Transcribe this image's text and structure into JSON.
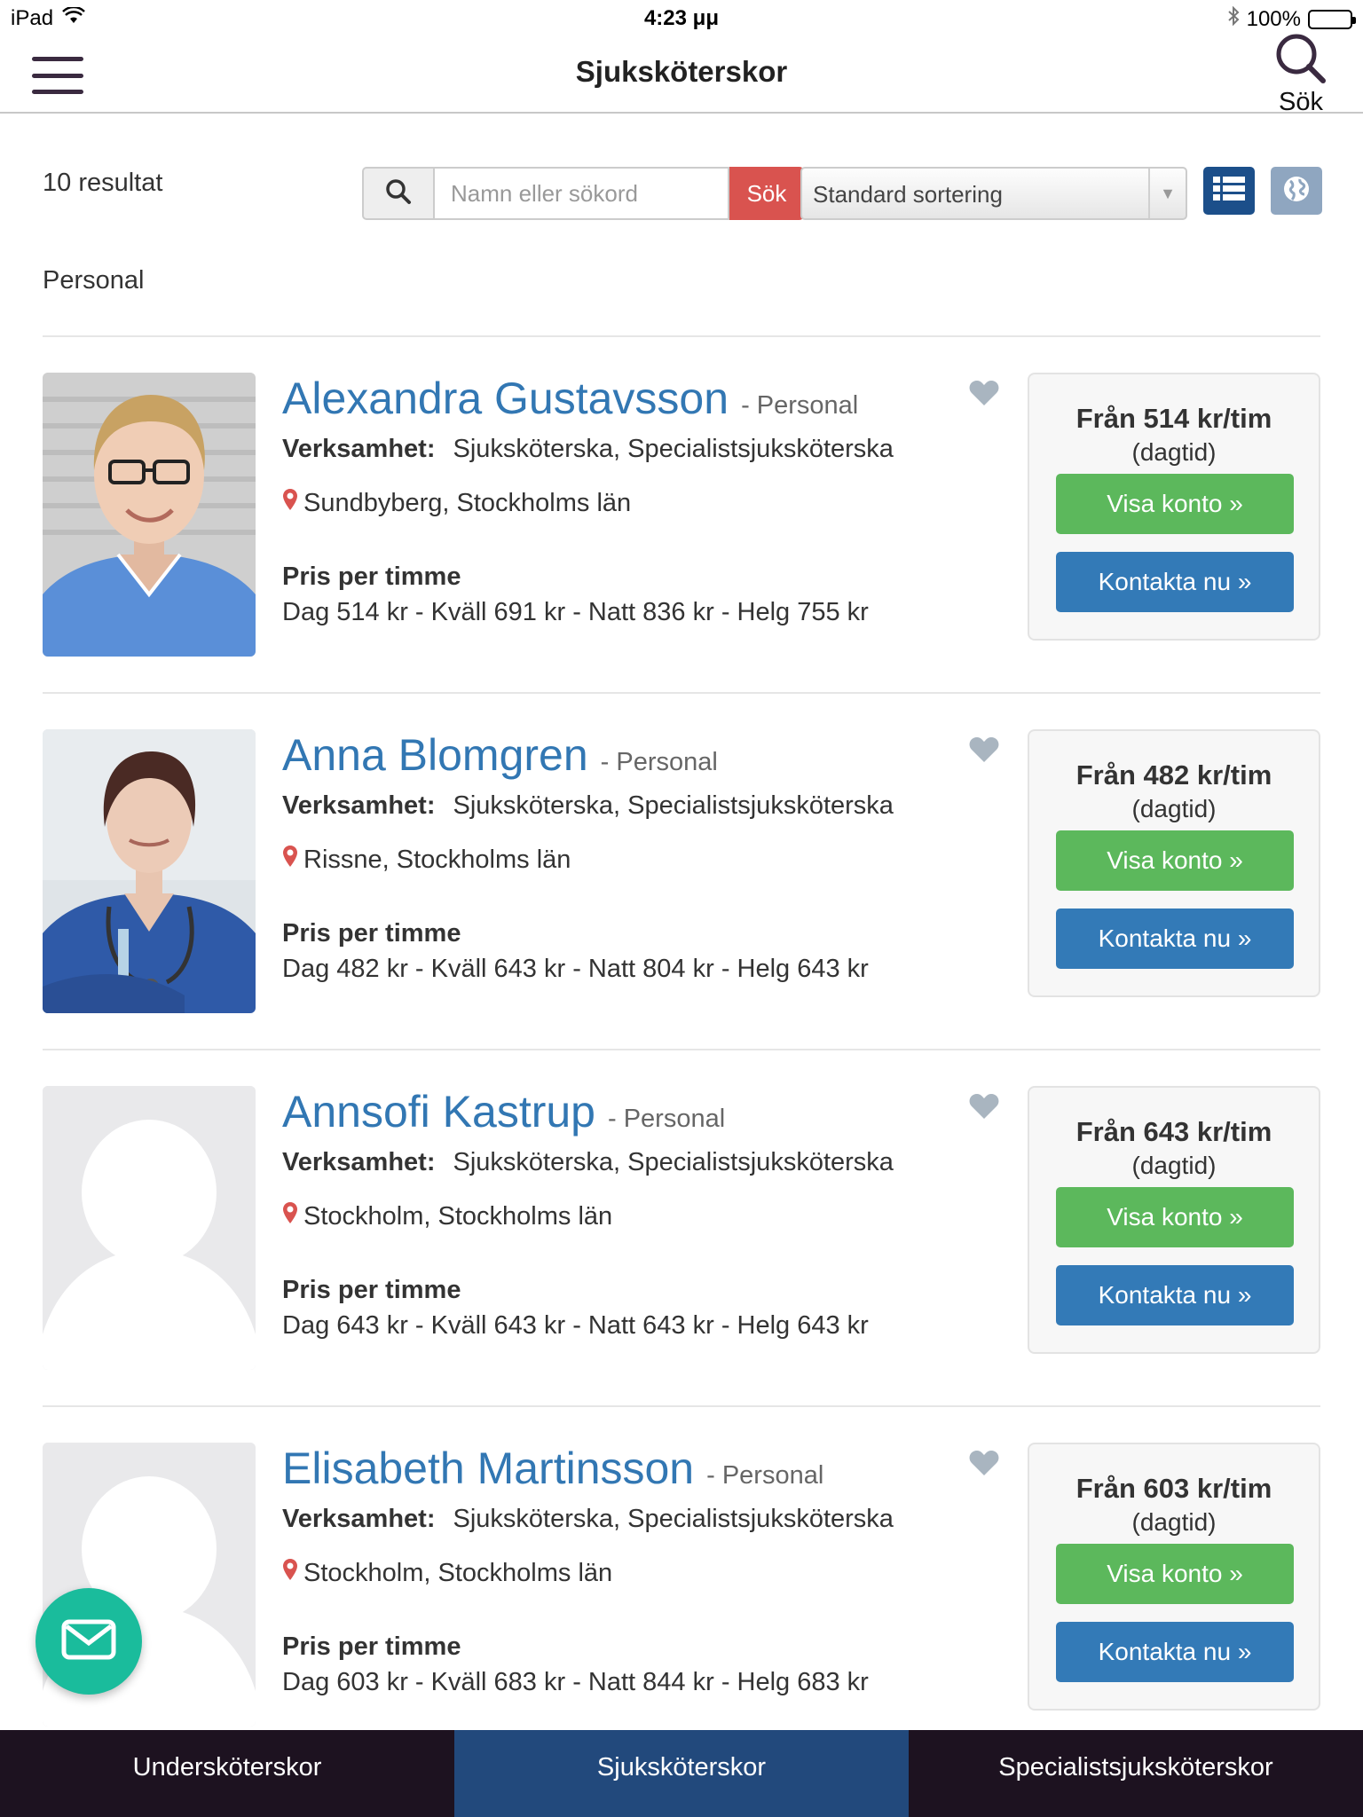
{
  "status_bar": {
    "device": "iPad",
    "time": "4:23 μμ",
    "battery": "100%"
  },
  "navbar": {
    "title": "Sjuksköterskor",
    "search_label": "Sök"
  },
  "results": {
    "count_text": "10 resultat",
    "section_label": "Personal"
  },
  "search": {
    "placeholder": "Namn eller sökord",
    "button_label": "Sök",
    "sort_value": "Standard sortering"
  },
  "profiles": [
    {
      "name": "Alexandra Gustavsson",
      "role": "- Personal",
      "field_label": "Verksamhet:",
      "field_value": "Sjuksköterska, Specialistsjuksköterska",
      "location": "Sundbyberg, Stockholms län",
      "price_title": "Pris per timme",
      "price_line": "Dag 514 kr - Kväll 691 kr - Natt 836 kr - Helg 755 kr",
      "from_price": "Från 514 kr/tim",
      "from_sub": "(dagtid)",
      "view_label": "Visa konto »",
      "contact_label": "Kontakta nu »"
    },
    {
      "name": "Anna Blomgren",
      "role": "- Personal",
      "field_label": "Verksamhet:",
      "field_value": "Sjuksköterska, Specialistsjuksköterska",
      "location": "Rissne, Stockholms län",
      "price_title": "Pris per timme",
      "price_line": "Dag 482 kr - Kväll 643 kr - Natt 804 kr - Helg 643 kr",
      "from_price": "Från 482 kr/tim",
      "from_sub": "(dagtid)",
      "view_label": "Visa konto »",
      "contact_label": "Kontakta nu »"
    },
    {
      "name": "Annsofi Kastrup",
      "role": "- Personal",
      "field_label": "Verksamhet:",
      "field_value": "Sjuksköterska, Specialistsjuksköterska",
      "location": "Stockholm, Stockholms län",
      "price_title": "Pris per timme",
      "price_line": "Dag 643 kr - Kväll 643 kr - Natt 643 kr - Helg 643 kr",
      "from_price": "Från 643 kr/tim",
      "from_sub": "(dagtid)",
      "view_label": "Visa konto »",
      "contact_label": "Kontakta nu »"
    },
    {
      "name": "Elisabeth Martinsson",
      "role": "- Personal",
      "field_label": "Verksamhet:",
      "field_value": "Sjuksköterska, Specialistsjuksköterska",
      "location": "Stockholm, Stockholms län",
      "price_title": "Pris per timme",
      "price_line": "Dag 603 kr - Kväll 683 kr - Natt 844 kr - Helg 683 kr",
      "from_price": "Från 603 kr/tim",
      "from_sub": "(dagtid)",
      "view_label": "Visa konto »",
      "contact_label": "Kontakta nu »"
    }
  ],
  "tabs": [
    {
      "label": "Undersköterskor",
      "active": false
    },
    {
      "label": "Sjuksköterskor",
      "active": true
    },
    {
      "label": "Specialistsjuksköterskor",
      "active": false
    }
  ],
  "colors": {
    "name_blue": "#3277b3",
    "green": "#5cb85c",
    "blue": "#337ab7",
    "red": "#d9534f",
    "tab_active": "#22497c",
    "tab_bg": "#1d1220",
    "fab": "#1abc9c"
  },
  "icons": {
    "menu": "hamburger-icon",
    "search": "magnifier-icon",
    "list_view": "list-icon",
    "map_view": "globe-icon",
    "favorite": "heart-icon",
    "location": "map-pin-icon",
    "mail": "envelope-icon"
  }
}
